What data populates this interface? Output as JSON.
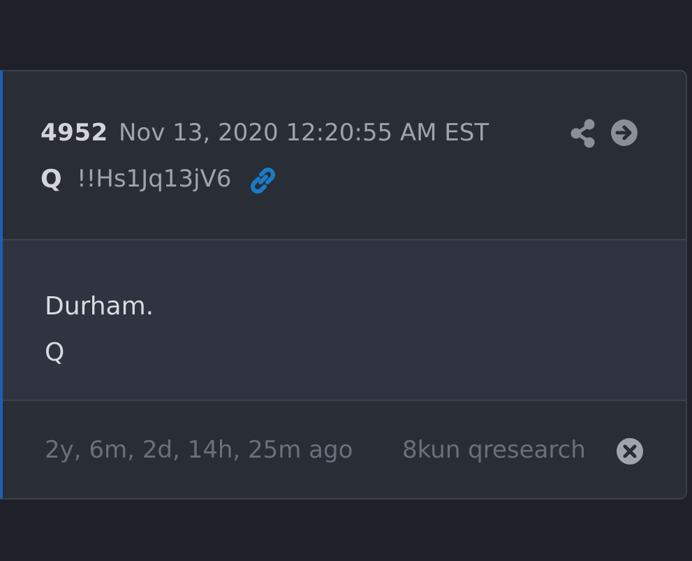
{
  "post": {
    "number": "4952",
    "date": "Nov 13, 2020 12:20:55 AM EST",
    "author": "Q",
    "tripcode": "!!Hs1Jq13jV6",
    "body_lines": [
      "Durham.",
      "Q"
    ],
    "age": "2y, 6m, 2d, 14h, 25m ago",
    "source": "8kun qresearch"
  },
  "icons": {
    "link": "link-icon",
    "share": "share-icon",
    "navigate": "arrow-right-circle-icon",
    "close": "close-circle-icon"
  },
  "colors": {
    "background": "#1e2129",
    "card": "#292d36",
    "body": "#2f3440",
    "accent_border": "#1f5fb3",
    "link_icon": "#1a7bc4",
    "primary_text": "#d3d5da",
    "secondary_text": "#9fa3ab",
    "muted_text": "#6a707b"
  }
}
